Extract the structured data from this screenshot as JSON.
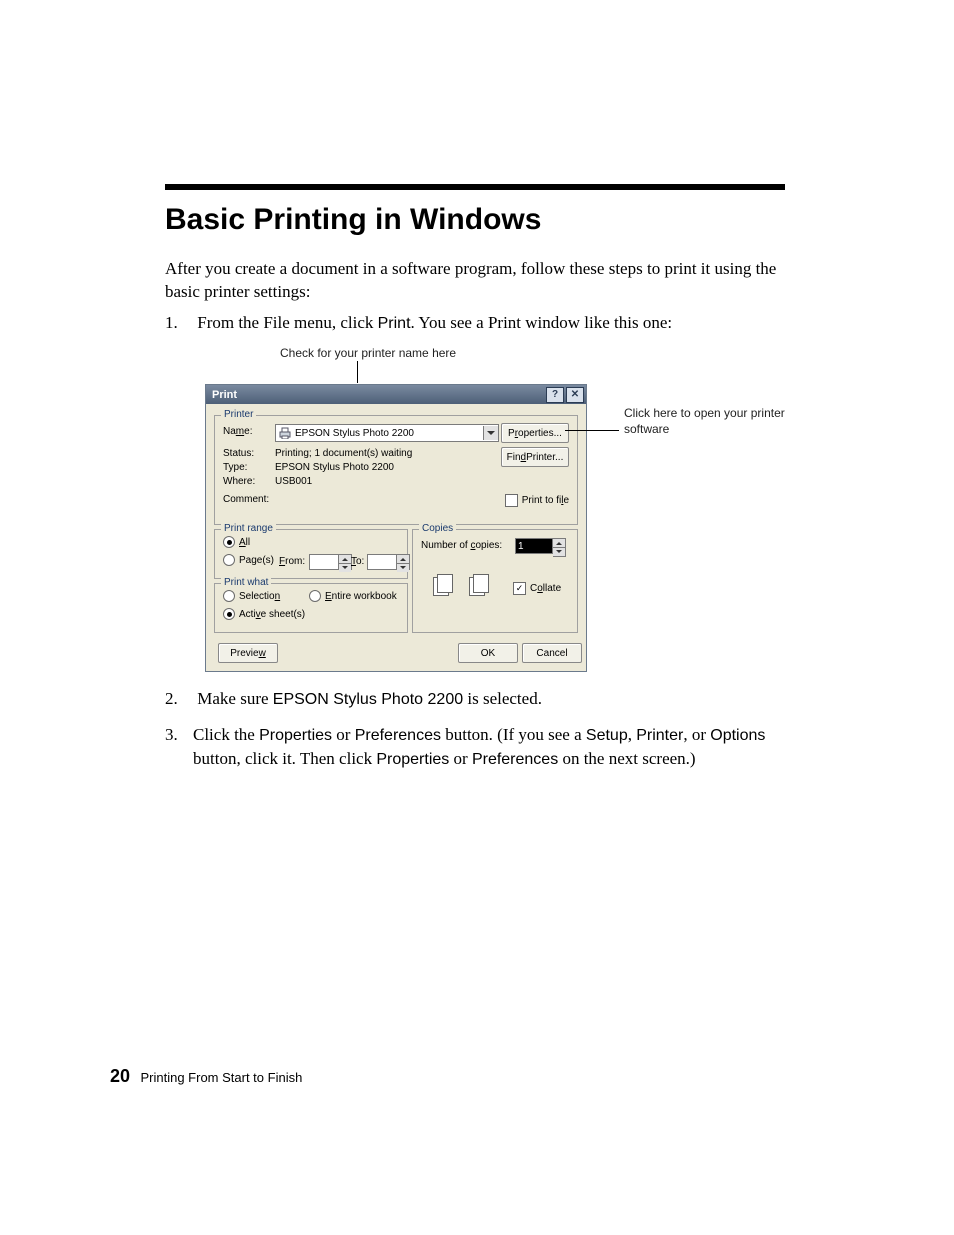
{
  "heading": "Basic Printing in Windows",
  "intro": "After you create a document in a software program, follow these steps to print it using the basic printer settings:",
  "steps": {
    "s1": {
      "num": "1.",
      "pre": "From the File menu, click ",
      "print": "Print",
      "post": ". You see a Print window like this one:"
    },
    "s2": {
      "num": "2.",
      "pre": "Make sure ",
      "product": "EPSON Stylus Photo 2200",
      "post": " is selected."
    },
    "s3": {
      "num": "3.",
      "t1": "Click the ",
      "properties": "Properties",
      "or": " or ",
      "preferences": "Preferences",
      "t2": " button. (If you see a ",
      "setup": "Setup",
      "comma": ", ",
      "printer": "Printer",
      "or2": ", or ",
      "options": "Options",
      "t3": " button, click it. Then click ",
      "properties2": "Properties",
      "or3": " or ",
      "preferences2": "Preferences",
      "t4": " on the next screen.)"
    }
  },
  "annotations": {
    "top": "Check for your printer name here",
    "right": "Click here to open your printer software"
  },
  "dialog": {
    "title": "Print",
    "printer": {
      "legend": "Printer",
      "name_label": "Name:",
      "name_value": "EPSON Stylus Photo 2200",
      "status_label": "Status:",
      "status_value": "Printing; 1 document(s) waiting",
      "type_label": "Type:",
      "type_value": "EPSON Stylus Photo 2200",
      "where_label": "Where:",
      "where_value": "USB001",
      "comment_label": "Comment:",
      "properties_btn": "Properties...",
      "find_btn": "Find Printer...",
      "print_to_file": "Print to file"
    },
    "range": {
      "legend": "Print range",
      "all": "All",
      "pages": "Page(s)",
      "from": "From:",
      "to": "To:"
    },
    "what": {
      "legend": "Print what",
      "selection": "Selection",
      "entire": "Entire workbook",
      "active": "Active sheet(s)"
    },
    "copies": {
      "legend": "Copies",
      "label": "Number of copies:",
      "value": "1",
      "collate": "Collate"
    },
    "buttons": {
      "preview": "Preview",
      "ok": "OK",
      "cancel": "Cancel"
    }
  },
  "footer": {
    "page": "20",
    "text": "Printing From Start to Finish"
  }
}
